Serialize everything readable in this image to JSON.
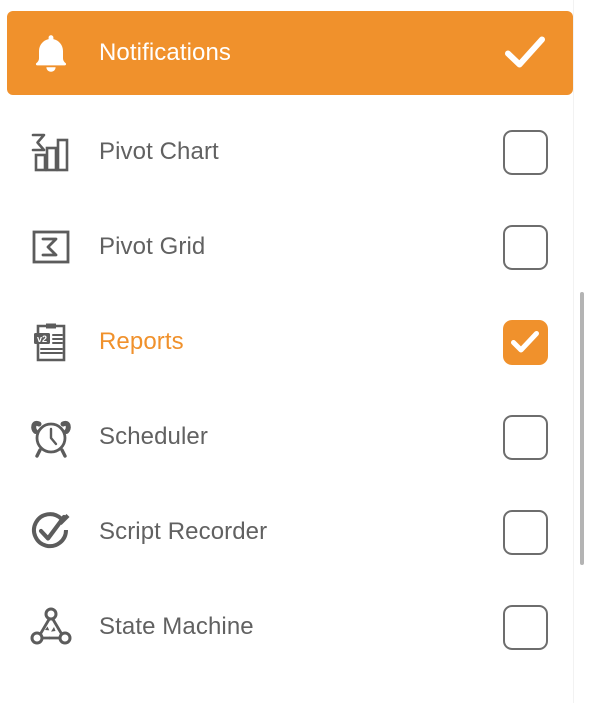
{
  "theme": {
    "accent": "#f0912c",
    "label_color": "#616161",
    "checkbox_border": "#6d6d6d",
    "background": "#ffffff",
    "scrollbar_thumb": "#b4b4b4"
  },
  "list": {
    "items": [
      {
        "label": "Notifications",
        "icon": "bell-icon",
        "selected": true,
        "checked": true,
        "checkbox_style": "bare"
      },
      {
        "label": "Pivot Chart",
        "icon": "pivot-chart-icon",
        "selected": false,
        "checked": false,
        "checkbox_style": "outline"
      },
      {
        "label": "Pivot Grid",
        "icon": "pivot-grid-icon",
        "selected": false,
        "checked": false,
        "checkbox_style": "outline"
      },
      {
        "label": "Reports",
        "icon": "reports-clipboard-icon",
        "selected": false,
        "checked": true,
        "checkbox_style": "filled"
      },
      {
        "label": "Scheduler",
        "icon": "alarm-clock-icon",
        "selected": false,
        "checked": false,
        "checkbox_style": "outline"
      },
      {
        "label": "Script Recorder",
        "icon": "script-recorder-icon",
        "selected": false,
        "checked": false,
        "checkbox_style": "outline"
      },
      {
        "label": "State Machine",
        "icon": "state-machine-icon",
        "selected": false,
        "checked": false,
        "checkbox_style": "outline"
      }
    ]
  },
  "reports_icon": {
    "badge_text": "v2"
  },
  "scrollbar": {
    "orientation": "vertical"
  }
}
